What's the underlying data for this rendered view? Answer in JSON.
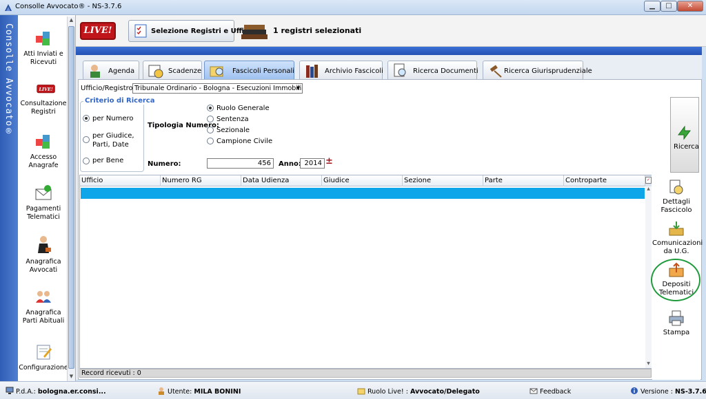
{
  "window": {
    "title": "Consolle Avvocato® - NS-3.7.6",
    "controls": {
      "minimize": "▁",
      "maximize": "□",
      "close": "✕"
    }
  },
  "brand": {
    "label": "Consolle Avvocato®"
  },
  "leftnav": {
    "items": [
      {
        "label": "Atti Inviati e Ricevuti",
        "icon": "shapes-icon"
      },
      {
        "label": "Consultazione Registri",
        "icon": "live-icon"
      },
      {
        "label": "Accesso Anagrafe",
        "icon": "shapes-icon"
      },
      {
        "label": "Pagamenti Telematici",
        "icon": "envelope-icon"
      },
      {
        "label": "Anagrafica Avvocati",
        "icon": "lawyer-icon"
      },
      {
        "label": "Anagrafica Parti Abituali",
        "icon": "people-icon"
      },
      {
        "label": "Configurazione",
        "icon": "settings-icon"
      }
    ]
  },
  "topbar": {
    "live_label": "LIVE!",
    "select_button": "Selezione Registri e Uffici",
    "registries_selected": "1 registri selezionati"
  },
  "tabs": [
    {
      "label": "Agenda",
      "active": false
    },
    {
      "label": "Scadenze",
      "active": false
    },
    {
      "label": "Fascicoli Personali",
      "active": true
    },
    {
      "label": "Archivio Fascicoli",
      "active": false
    },
    {
      "label": "Ricerca Documenti",
      "active": false
    },
    {
      "label": "Ricerca Giurisprudenziale",
      "active": false
    }
  ],
  "form": {
    "ufficio_label": "Ufficio/Registro:",
    "ufficio_value": "Tribunale Ordinario - Bologna - Esecuzioni Immobiliari",
    "criterio_title": "Criterio di Ricerca",
    "criterio_options": [
      {
        "label": "per Numero",
        "selected": true
      },
      {
        "label": "per Giudice, Parti, Date",
        "selected": false
      },
      {
        "label": "per Bene",
        "selected": false
      }
    ],
    "tipologia_label": "Tipologia Numero:",
    "tipologia_options": [
      {
        "label": "Ruolo Generale",
        "selected": true
      },
      {
        "label": "Sentenza",
        "selected": false
      },
      {
        "label": "Sezionale",
        "selected": false
      },
      {
        "label": "Campione Civile",
        "selected": false
      }
    ],
    "numero_label": "Numero:",
    "numero_value": "456",
    "anno_label": "Anno:",
    "anno_value": "2014",
    "plusminus": "±",
    "ricerca_button": "Ricerca"
  },
  "table": {
    "columns": [
      "Ufficio",
      "Numero RG",
      "Data Udienza",
      "Giudice",
      "Sezione",
      "Parte",
      "Controparte"
    ],
    "rows": [],
    "record_label": "Record ricevuti : 0"
  },
  "actions": [
    {
      "label": "Dettagli Fascicolo",
      "icon": "document-magnifier-icon"
    },
    {
      "label": "Comunicazioni da U.G.",
      "icon": "inbox-arrow-icon"
    },
    {
      "label": "Depositi Telematici",
      "icon": "tray-upload-icon",
      "highlighted": true
    },
    {
      "label": "Stampa",
      "icon": "printer-icon"
    }
  ],
  "status": {
    "pda_label": "P.d.A.:",
    "pda_value": "bologna.er.consi...",
    "user_label": "Utente:",
    "user_value": "MILA BONINI",
    "ruolo_label": "Ruolo Live! :",
    "ruolo_value": "Avvocato/Delegato",
    "feedback": "Feedback",
    "version_label": "Versione :",
    "version_value": "NS-3.7.6"
  },
  "colors": {
    "accent_blue": "#2451b3",
    "selection_row": "#0ea5e9",
    "live_red": "#c0161b",
    "highlight_ring": "#1f9b3c"
  }
}
